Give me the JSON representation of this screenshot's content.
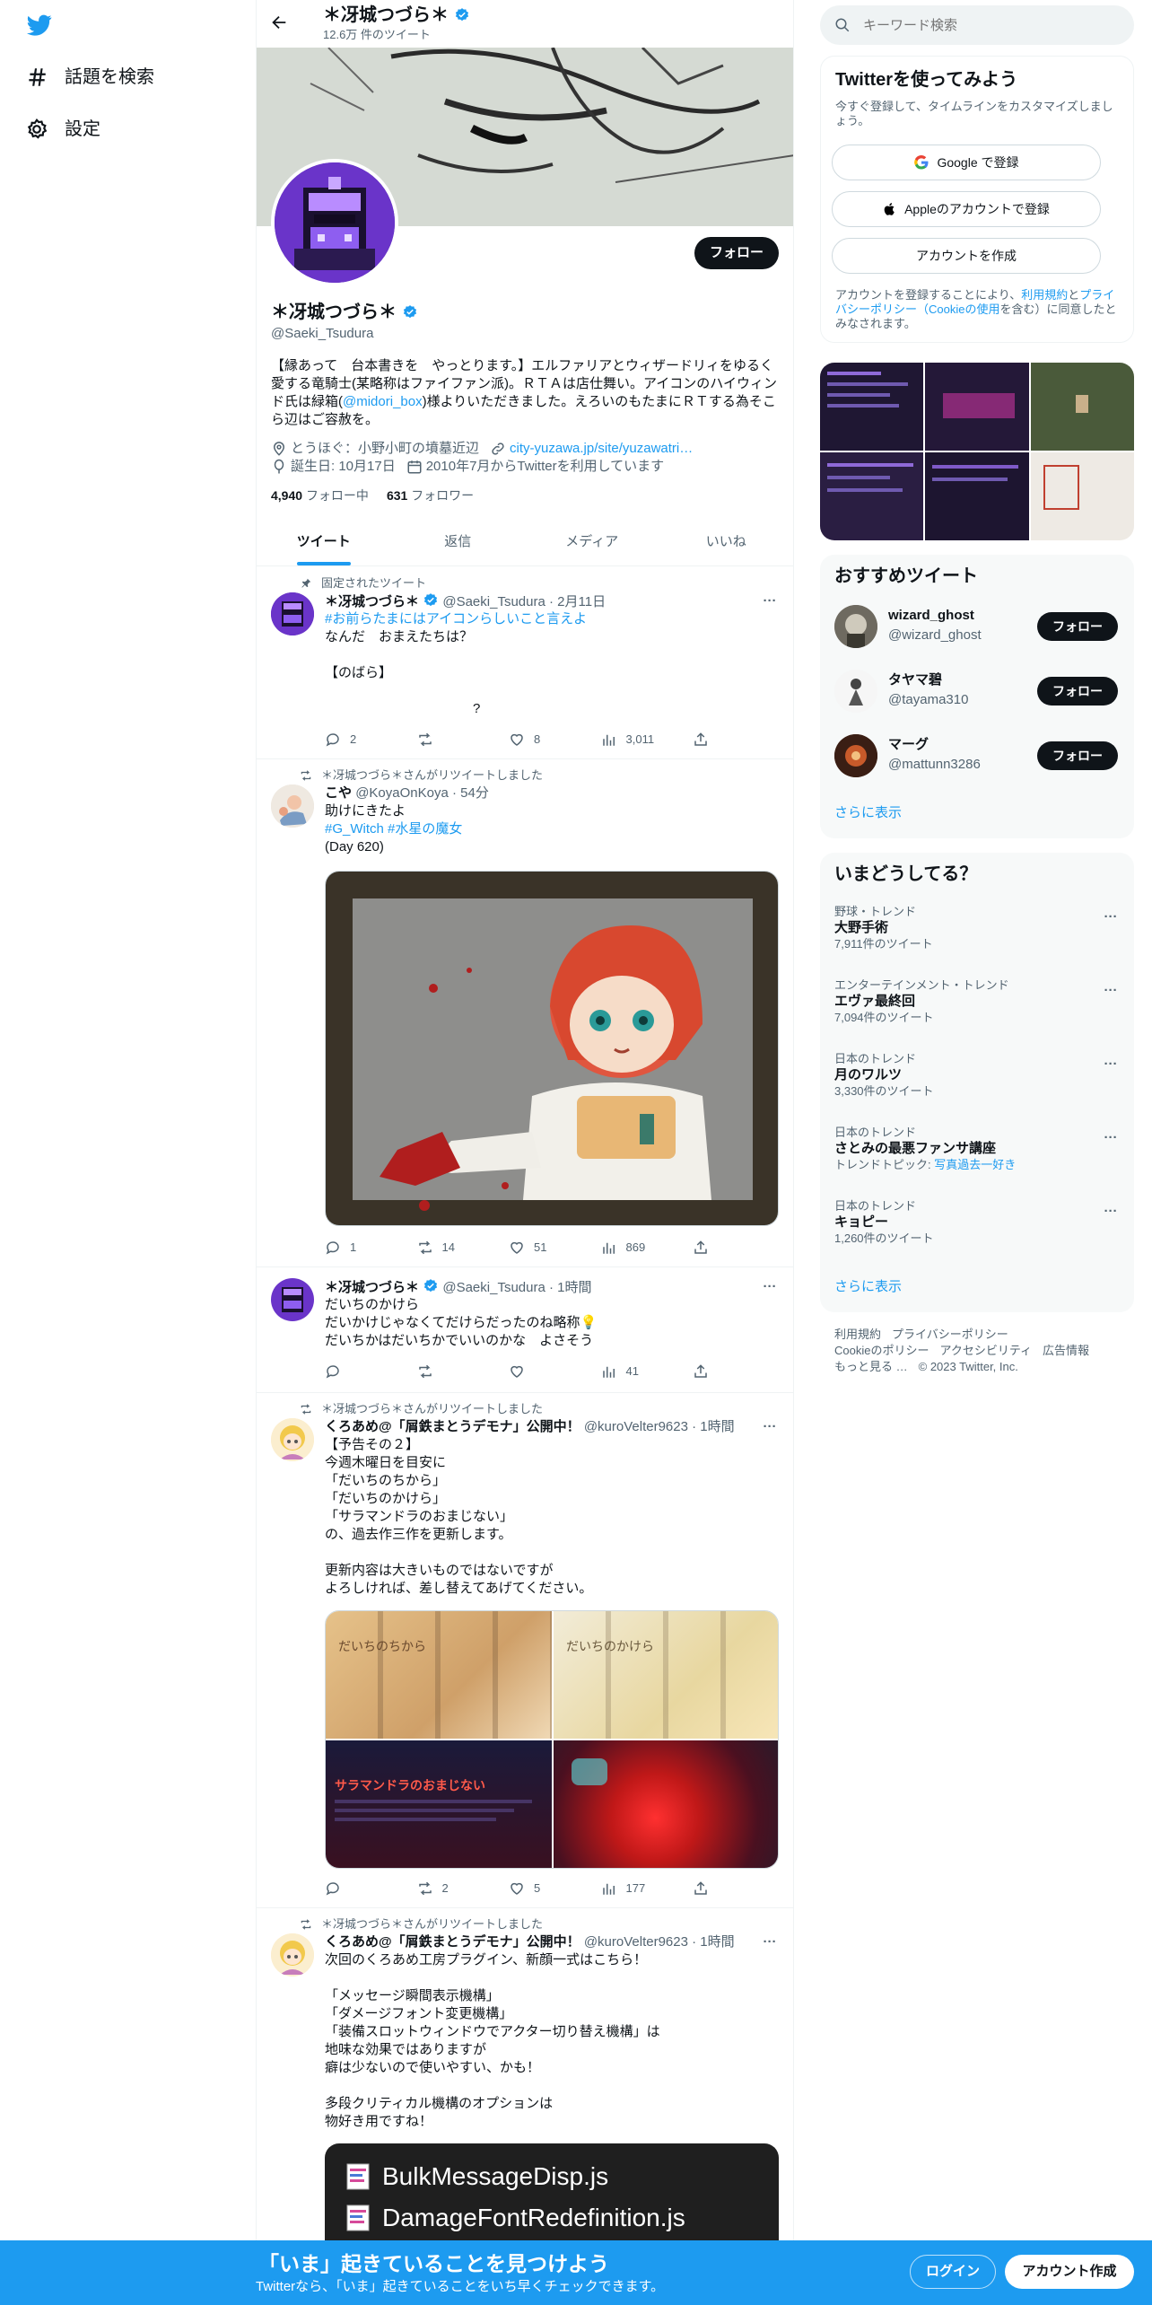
{
  "nav": {
    "explore_label": "話題を検索",
    "settings_label": "設定"
  },
  "header": {
    "name": "＊冴城つづら＊",
    "tweet_count": "12.6万 件のツイート"
  },
  "profile": {
    "name": "＊冴城つづら＊",
    "handle": "@Saeki_Tsudura",
    "follow_label": "フォロー",
    "bio_1": "【縁あって　台本書きを　やっとります。】エルファリアとウィザードリィをゆるく愛する竜騎士(某略称はファイファン派)。ＲＴＡは店仕舞い。アイコンのハイウィンド氏は緑箱(",
    "bio_link": "@midori_box",
    "bio_2": ")様よりいただきました。えろいのもたまにＲＴする為そこら辺はご容赦を。",
    "location": "とうほぐ：小野小町の墳墓近辺",
    "url": "city-yuzawa.jp/site/yuzawatri…",
    "birthday": "誕生日: 10月17日",
    "joined": "2010年7月からTwitterを利用しています",
    "following_count": "4,940",
    "following_label": "フォロー中",
    "followers_count": "631",
    "followers_label": "フォロワー"
  },
  "tabs": [
    "ツイート",
    "返信",
    "メディア",
    "いいね"
  ],
  "tweets": [
    {
      "context": "固定されたツイート",
      "name": "＊冴城つづら＊",
      "handle": "@Saeki_Tsudura",
      "time": "2月11日",
      "hashtag": "#お前らたまにはアイコンらしいこと言えよ",
      "text": "なんだ　おまえたちは？\n\n【のばら】\n\n　　　　　　　　　　　?",
      "replies": "2",
      "retweets": "",
      "likes": "8",
      "views": "3,011"
    },
    {
      "context": "＊冴城つづら＊さんがリツイートしました",
      "name": "こや",
      "handle": "@KoyaOnKoya",
      "time": "54分",
      "text_1": "助けにきたよ",
      "hashtags": "#G_Witch #水星の魔女",
      "text_2": "(Day 620)",
      "replies": "1",
      "retweets": "14",
      "likes": "51",
      "views": "869"
    },
    {
      "name": "＊冴城つづら＊",
      "handle": "@Saeki_Tsudura",
      "time": "1時間",
      "text": "だいちのかけら\nだいかけじゃなくてだけらだったのね略称💡\nだいちかはだいちかでいいのかな　よさそう",
      "replies": "",
      "retweets": "",
      "likes": "",
      "views": "41"
    },
    {
      "context": "＊冴城つづら＊さんがリツイートしました",
      "name": "くろあめ@「屑鉄まとうデモナ」公開中！",
      "handle": "@kuroVelter9623",
      "time": "1時間",
      "text": "【予告その２】\n今週木曜日を目安に\n「だいちのちから」\n「だいちのかけら」\n「サラマンドラのおまじない」\nの、過去作三作を更新します。\n\n更新内容は大きいものではないですが\nよろしければ、差し替えてあげてください。",
      "img_titles": [
        "だいちのちから",
        "だいちのかけら",
        "サラマンドラのおまじない",
        ""
      ],
      "replies": "",
      "retweets": "2",
      "likes": "5",
      "views": "177"
    },
    {
      "context": "＊冴城つづら＊さんがリツイートしました",
      "name": "くろあめ@「屑鉄まとうデモナ」公開中！",
      "handle": "@kuroVelter9623",
      "time": "1時間",
      "text": "次回のくろあめ工房プラグイン、新顔一式はこちら！\n\n「メッセージ瞬間表示機構」\n「ダメージフォント変更機構」\n「装備スロットウィンドウでアクター切り替え機構」は\n地味な効果ではありますが\n癖は少ないので使いやすい、かも！\n\n多段クリティカル機構のオプションは\n物好き用ですね！",
      "files": [
        "BulkMessageDisp.js",
        "DamageFontRedefinition.js"
      ]
    }
  ],
  "right": {
    "search_placeholder": "キーワード検索",
    "signup": {
      "title": "Twitterを使ってみよう",
      "desc": "今すぐ登録して、タイムラインをカスタマイズしましょう。",
      "google": "Google で登録",
      "apple": "Appleのアカウントで登録",
      "create": "アカウントを作成",
      "terms_1": "アカウントを登録することにより、",
      "terms_link1": "利用規約",
      "terms_2": "と",
      "terms_link2": "プライバシーポリシー（Cookieの使用",
      "terms_3": "を含む）に同意したとみなされます。"
    },
    "suggest": {
      "title": "おすすめツイート",
      "follow_label": "フォロー",
      "users": [
        {
          "name": "wizard_ghost",
          "handle": "@wizard_ghost"
        },
        {
          "name": "タヤマ碧",
          "handle": "@tayama310"
        },
        {
          "name": "マーグ",
          "handle": "@mattunn3286"
        }
      ],
      "more": "さらに表示"
    },
    "trends": {
      "title": "いまどうしてる？",
      "items": [
        {
          "cat": "野球・トレンド",
          "name": "大野手術",
          "count": "7,911件のツイート"
        },
        {
          "cat": "エンターテインメント・トレンド",
          "name": "エヴァ最終回",
          "count": "7,094件のツイート"
        },
        {
          "cat": "日本のトレンド",
          "name": "月のワルツ",
          "count": "3,330件のツイート"
        },
        {
          "cat": "日本のトレンド",
          "name": "さとみの最悪ファンサ講座",
          "count_prefix": "トレンドトピック: ",
          "count_link": "写真過去一好き"
        },
        {
          "cat": "日本のトレンド",
          "name": "キョピー",
          "count": "1,260件のツイート"
        }
      ],
      "more": "さらに表示"
    },
    "footer": {
      "terms": "利用規約",
      "privacy": "プライバシーポリシー",
      "cookie": "Cookieのポリシー",
      "access": "アクセシビリティ",
      "ads": "広告情報",
      "more": "もっと見る …",
      "copy": "© 2023 Twitter, Inc."
    }
  },
  "bottom": {
    "title": "「いま」起きていることを見つけよう",
    "sub": "Twitterなら、「いま」起きていることをいち早くチェックできます。",
    "login": "ログイン",
    "signup": "アカウント作成"
  },
  "colors": {
    "accent": "#1d9bf0",
    "text": "#0f1419",
    "muted": "#536471",
    "border": "#eff3f4"
  }
}
